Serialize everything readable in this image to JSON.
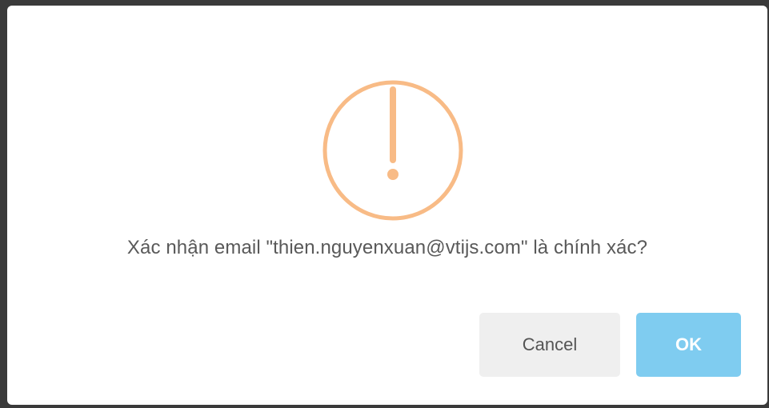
{
  "dialog": {
    "icon": "warning-exclamation-icon",
    "icon_color": "#f8bb86",
    "message": "Xác nhận email \"thien.nguyenxuan@vtijs.com\" là chính xác?",
    "cancel_label": "Cancel",
    "ok_label": "OK",
    "cancel_color": "#efefef",
    "ok_color": "#7fccf0"
  }
}
